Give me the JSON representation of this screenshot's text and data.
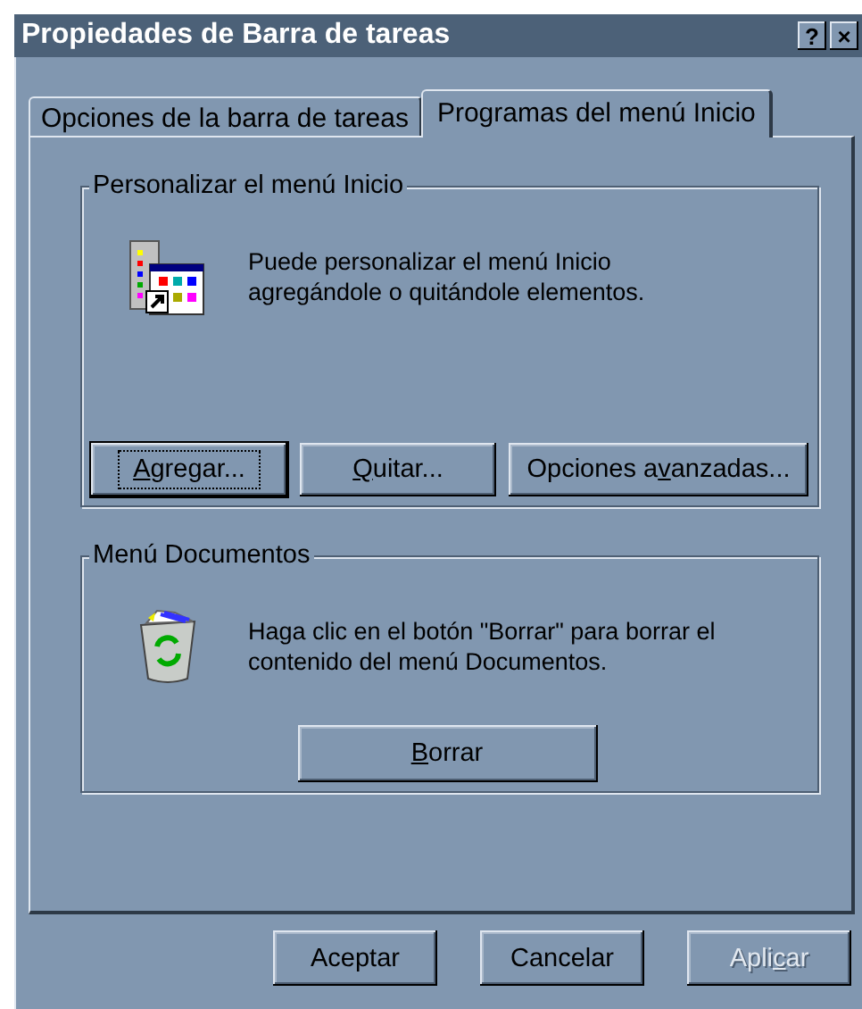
{
  "window": {
    "title": "Propiedades de Barra de tareas",
    "title_buttons": [
      "?",
      "×"
    ]
  },
  "tabs": [
    {
      "label": "Opciones de la barra de tareas",
      "selected": false
    },
    {
      "label": "Programas del menú Inicio",
      "selected": true
    }
  ],
  "groups": [
    {
      "title": "Personalizar el menú Inicio",
      "kind": "programs",
      "text": "Puede personalizar el menú Inicio agregándole o quitándole elementos.",
      "buttons": [
        {
          "key": "A",
          "post": "gregar...",
          "default": true,
          "disabled": false
        },
        {
          "key": "Q",
          "post": "uitar...",
          "default": false,
          "disabled": false
        },
        {
          "pre": "Opciones a",
          "key": "v",
          "post": "anzadas...",
          "default": false,
          "disabled": false
        }
      ]
    },
    {
      "title": "Menú Documentos",
      "kind": "recycle",
      "text": "Haga clic en el botón \"Borrar\" para borrar el contenido del menú Documentos.",
      "buttons": [
        {
          "key": "B",
          "post": "orrar",
          "default": false,
          "disabled": false
        }
      ]
    }
  ],
  "dialog_buttons": [
    {
      "pre": "Aceptar",
      "default": false,
      "disabled": false
    },
    {
      "pre": "Cancelar",
      "default": false,
      "disabled": false
    },
    {
      "pre": "Apli",
      "key": "c",
      "post": "ar",
      "default": false,
      "disabled": true
    }
  ]
}
